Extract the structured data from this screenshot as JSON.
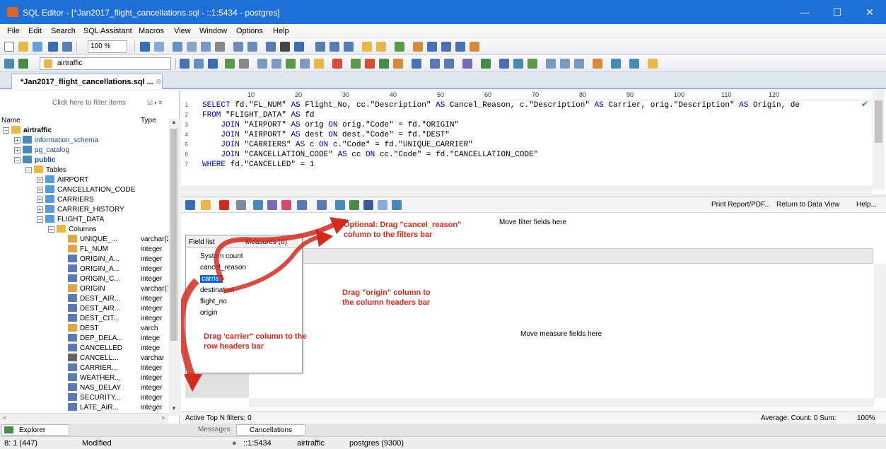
{
  "window": {
    "title": "SQL Editor - [*Jan2017_flight_cancellations.sql - ::1:5434 - postgres]"
  },
  "menu": [
    "File",
    "Edit",
    "Search",
    "SQL Assistant",
    "Macros",
    "View",
    "Window",
    "Options",
    "Help"
  ],
  "toolbar": {
    "zoom": "100 %",
    "database": "airtraffic"
  },
  "tab": {
    "label": "*Jan2017_flight_cancellations.sql ..."
  },
  "explorer": {
    "filter_placeholder": "Click here to filter items",
    "col_name": "Name",
    "col_type": "Type",
    "tree": [
      {
        "label": "airtraffic",
        "bold": true
      },
      {
        "label": "information_schema"
      },
      {
        "label": "pg_catalog"
      },
      {
        "label": "public",
        "bold": true
      },
      {
        "label": "Tables"
      },
      {
        "label": "AIRPORT"
      },
      {
        "label": "CANCELLATION_CODE"
      },
      {
        "label": "CARRIERS"
      },
      {
        "label": "CARRIER_HISTORY"
      },
      {
        "label": "FLIGHT_DATA"
      },
      {
        "label": "Columns"
      }
    ],
    "columns": [
      {
        "name": "UNIQUE_...",
        "type": "varchar(2",
        "icon": "text"
      },
      {
        "name": "FL_NUM",
        "type": "integer",
        "icon": "text"
      },
      {
        "name": "ORIGIN_A...",
        "type": "integer",
        "icon": "num"
      },
      {
        "name": "ORIGIN_A...",
        "type": "integer",
        "icon": "num"
      },
      {
        "name": "ORIGIN_C...",
        "type": "integer",
        "icon": "num"
      },
      {
        "name": "ORIGIN",
        "type": "varchar(7",
        "icon": "text"
      },
      {
        "name": "DEST_AIR...",
        "type": "integer",
        "icon": "num"
      },
      {
        "name": "DEST_AIR...",
        "type": "integer",
        "icon": "num"
      },
      {
        "name": "DEST_CIT...",
        "type": "integer",
        "icon": "num"
      },
      {
        "name": "DEST",
        "type": "varch",
        "icon": "text"
      },
      {
        "name": "DEP_DELA...",
        "type": "intege",
        "icon": "num"
      },
      {
        "name": "CANCELLED",
        "type": "intege",
        "icon": "num"
      },
      {
        "name": "CANCELL...",
        "type": "varchar",
        "icon": "abc"
      },
      {
        "name": "CARRIER...",
        "type": "integer",
        "icon": "num"
      },
      {
        "name": "WEATHER...",
        "type": "integer",
        "icon": "num"
      },
      {
        "name": "NAS_DELAY",
        "type": "integer",
        "icon": "num"
      },
      {
        "name": "SECURITY...",
        "type": "integer",
        "icon": "num"
      },
      {
        "name": "LATE_AIR...",
        "type": "integer",
        "icon": "num"
      }
    ]
  },
  "sql": [
    "SELECT fd.\"FL_NUM\" AS Flight_No, cc.\"Description\" AS Cancel_Reason, c.\"Description\" AS Carrier, orig.\"Description\" AS Origin, de",
    "FROM \"FLIGHT_DATA\" AS fd",
    "    JOIN \"AIRPORT\" AS orig ON orig.\"Code\" = fd.\"ORIGIN\"",
    "    JOIN \"AIRPORT\" AS dest ON dest.\"Code\" = fd.\"DEST\"",
    "    JOIN \"CARRIERS\" AS c ON c.\"Code\" = fd.\"UNIQUE_CARRIER\"",
    "    JOIN \"CANCELLATION_CODE\" AS cc ON cc.\"Code\" = fd.\"CANCELLATION_CODE\"",
    "WHERE fd.\"CANCELLED\" = 1"
  ],
  "ruler": [
    "10",
    "20",
    "30",
    "40",
    "50",
    "60",
    "70",
    "80",
    "90",
    "100",
    "110",
    "120"
  ],
  "pivot": {
    "print_report": "Print Report/PDF...",
    "return_data_view": "Return to Data View",
    "help": "Help...",
    "filter_hint": "Move filter fields here",
    "measure_hint": "Move measure fields here",
    "field_list_tab": "Field list",
    "measures_tab": "Measures (0)",
    "fields": [
      "System count",
      "cancel_reason",
      "carrier",
      "destination",
      "flight_no",
      "origin"
    ],
    "active_filters": "Active Top N filters: 0",
    "summary": "Average:  Count: 0  Sum:",
    "zoom": "100%"
  },
  "annotations": {
    "a1_line1": "Optional: Drag \"cancel_reason\"",
    "a1_line2": "column to the filters bar",
    "a2_line1": "Drag \"origin\" column to",
    "a2_line2": "the column headers  bar",
    "a3_line1": "Drag 'carrier\" column to the",
    "a3_line2": "row headers bar"
  },
  "bottom_tabs": {
    "explorer": "Explorer",
    "messages": "Messages",
    "cancellations": "Cancellations"
  },
  "status": {
    "position": "8: 1 (447)",
    "modified": "Modified",
    "server": "::1:5434",
    "db": "airtraffic",
    "user": "postgres (9300)"
  },
  "colors": {
    "titlebar": "#1e6fd8",
    "annotation": "#d22b1e",
    "selection": "#0a64d6"
  }
}
